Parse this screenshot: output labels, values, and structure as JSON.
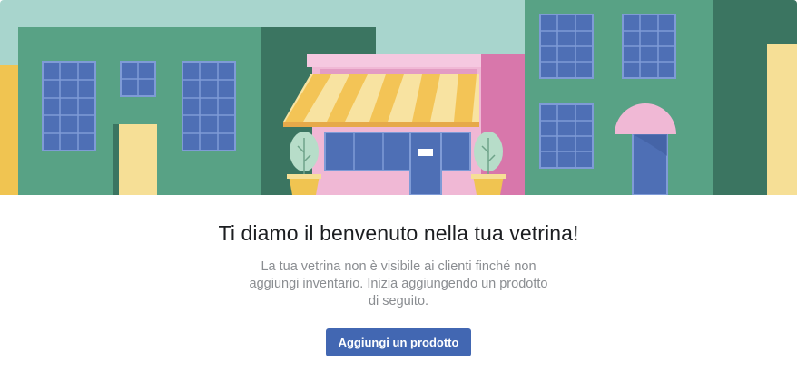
{
  "banner": {
    "alt": "storefront-illustration",
    "colors": {
      "sky": "#a8d5cd",
      "building_green": "#58a285",
      "building_dark_green": "#3b7561",
      "window_blue": "#4e6fb5",
      "window_frame": "#7f9bd6",
      "door_yellow": "#f6df96",
      "shop_pink": "#f0b8d5",
      "shop_magenta": "#d877ab",
      "awning_yellow": "#f3c456",
      "awning_light": "#f8e3a1",
      "plant_green": "#b7ddc9",
      "side_yellow": "#f0c451"
    }
  },
  "welcome": {
    "title": "Ti diamo il benvenuto nella tua vetrina!",
    "description": "La tua vetrina non è visibile ai clienti finché non aggiungi inventario. Inizia aggiungendo un prodotto di seguito."
  },
  "actions": {
    "add_product_label": "Aggiungi un prodotto"
  }
}
